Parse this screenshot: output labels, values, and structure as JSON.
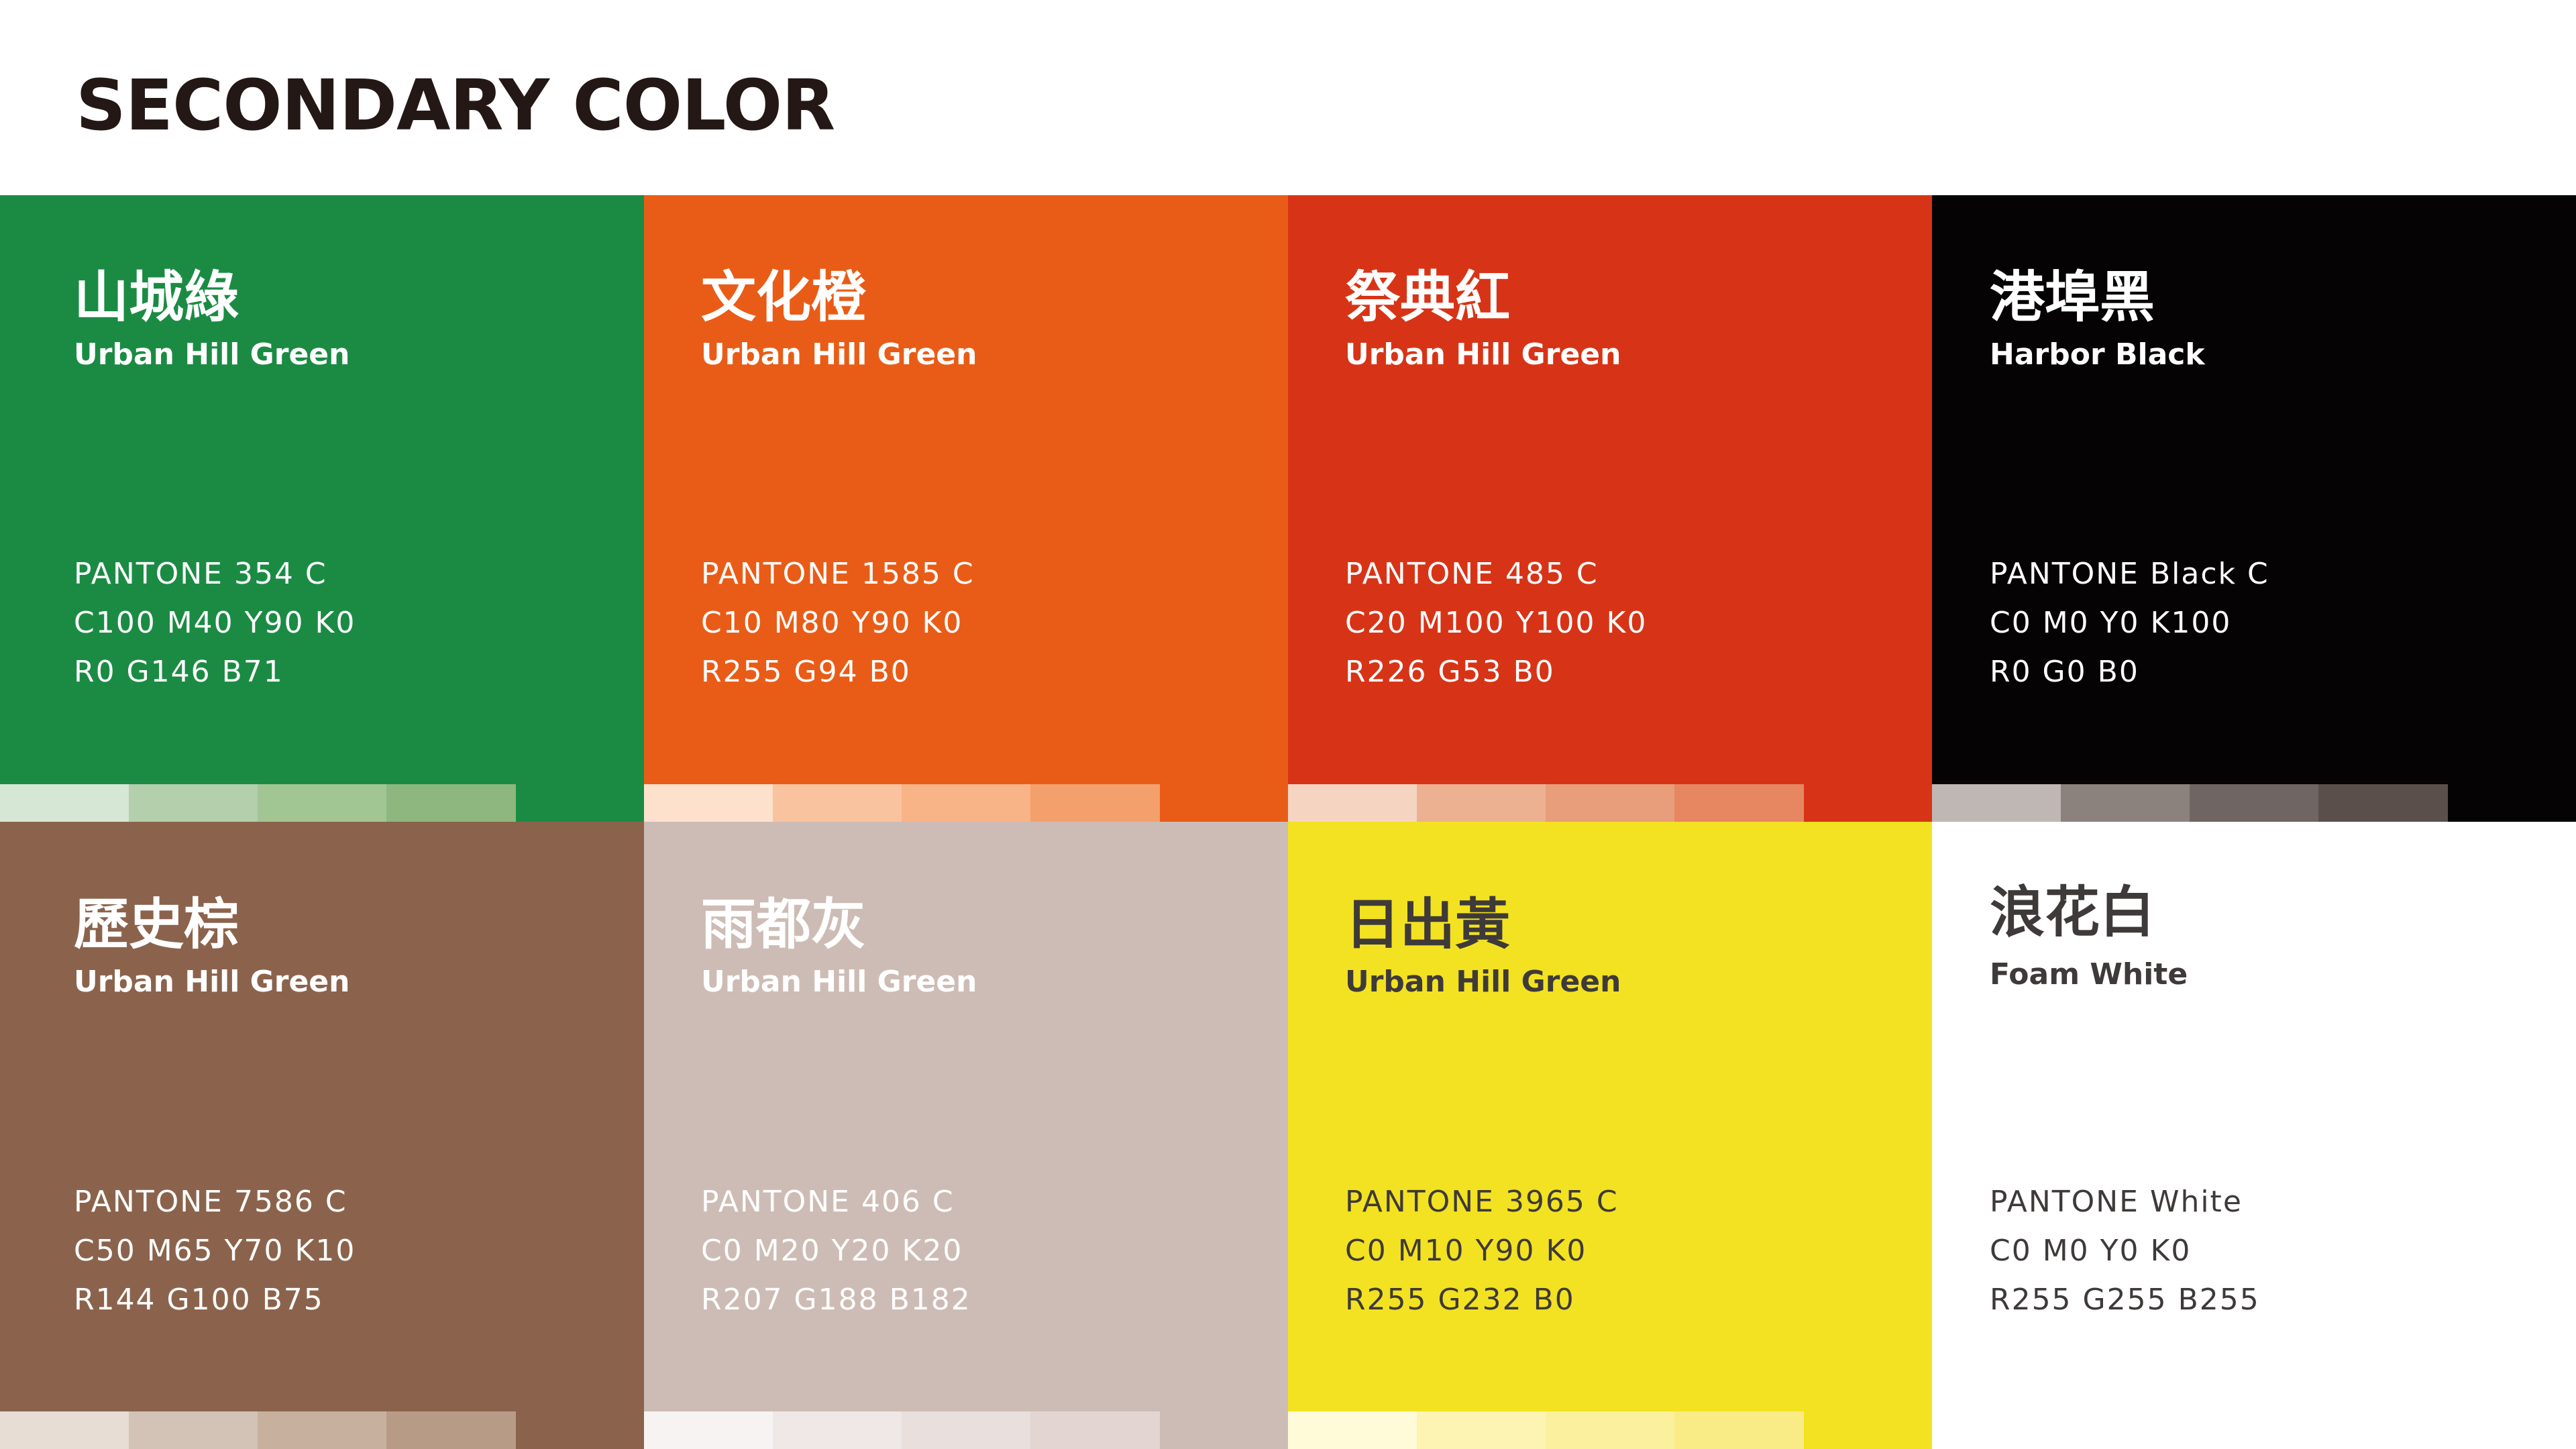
{
  "title": "SECONDARY COLOR",
  "swatches": [
    {
      "name": "山城綠",
      "subtitle": "Urban Hill Green",
      "pantone": "PANTONE 354 C",
      "cmyk": "C100 M40 Y90 K0",
      "rgb": "R0 G146 B71",
      "bg": "#1b8b44",
      "text": "#ffffff",
      "tints": [
        "#d7e7d6",
        "#b3cfac",
        "#a2c594",
        "#8db77f"
      ]
    },
    {
      "name": "文化橙",
      "subtitle": "Urban Hill Green",
      "pantone": "PANTONE 1585 C",
      "cmyk": "C10 M80 Y90 K0",
      "rgb": "R255 G94 B0",
      "bg": "#e95c17",
      "text": "#ffffff",
      "tints": [
        "#fde1cc",
        "#f9c3a0",
        "#f8b386",
        "#f4a06c"
      ]
    },
    {
      "name": "祭典紅",
      "subtitle": "Urban Hill Green",
      "pantone": "PANTONE 485 C",
      "cmyk": "C20 M100 Y100 K0",
      "rgb": "R226 G53 B0",
      "bg": "#d73417",
      "text": "#ffffff",
      "tints": [
        "#f5d5c2",
        "#ecb191",
        "#e89e7a",
        "#e68762"
      ]
    },
    {
      "name": "港埠黑",
      "subtitle": "Harbor Black",
      "pantone": "PANTONE Black C",
      "cmyk": "C0 M0 Y0 K100",
      "rgb": "R0 G0 B0",
      "bg": "#050303",
      "text": "#ffffff",
      "tints": [
        "#bfb7b3",
        "#8b817d",
        "#6f6562",
        "#5b4f4b"
      ]
    },
    {
      "name": "歷史棕",
      "subtitle": "Urban Hill Green",
      "pantone": "PANTONE 7586 C",
      "cmyk": "C50 M65 Y70 K10",
      "rgb": "R144 G100 B75",
      "bg": "#8b634c",
      "text": "#ffffff",
      "tints": [
        "#e7ddd4",
        "#d2c3b6",
        "#c7b09e",
        "#b89b87"
      ]
    },
    {
      "name": "雨都灰",
      "subtitle": "Urban Hill Green",
      "pantone": "PANTONE 406 C",
      "cmyk": "C0 M20 Y20 K20",
      "rgb": "R207 G188 B182",
      "bg": "#cdbcb5",
      "text": "#ffffff",
      "tints": [
        "#f7f3f2",
        "#efe8e6",
        "#e9dfdc",
        "#e3d6d2"
      ]
    },
    {
      "name": "日出黃",
      "subtitle": "Urban Hill Green",
      "pantone": "PANTONE 3965 C",
      "cmyk": "C0 M10 Y90 K0",
      "rgb": "R255 G232 B0",
      "bg": "#f3e221",
      "text": "#3e3a39",
      "tints": [
        "#fffbd9",
        "#fdf3b2",
        "#fbf09d",
        "#f9ec86"
      ]
    },
    {
      "name": "浪花白",
      "subtitle": "Foam White",
      "pantone": "PANTONE White",
      "cmyk": "C0 M0 Y0 K0",
      "rgb": "R255 G255 B255",
      "bg": "#ffffff",
      "text": "#3e3a39",
      "tints": []
    }
  ]
}
